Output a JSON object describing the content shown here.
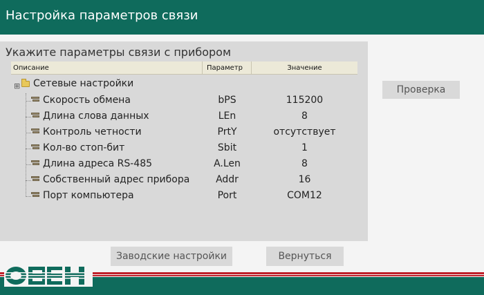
{
  "window": {
    "title": "Настройка параметров связи"
  },
  "panel": {
    "heading": "Укажите параметры связи с прибором",
    "columns": {
      "description": "Описание",
      "parameter": "Параметр",
      "value": "Значение"
    },
    "group_label": "Сетевые настройки",
    "rows": [
      {
        "name": "Скорость обмена",
        "param": "bPS",
        "value": "115200"
      },
      {
        "name": "Длина слова данных",
        "param": "LEn",
        "value": "8"
      },
      {
        "name": "Контроль четности",
        "param": "PrtY",
        "value": "отсутствует"
      },
      {
        "name": "Кол-во стоп-бит",
        "param": "Sbit",
        "value": "1"
      },
      {
        "name": "Длина адреса RS-485",
        "param": "A.Len",
        "value": "8"
      },
      {
        "name": "Собственный адрес прибора",
        "param": "Addr",
        "value": "16"
      },
      {
        "name": "Порт компьютера",
        "param": "Port",
        "value": "COM12"
      }
    ]
  },
  "buttons": {
    "check": "Проверка",
    "factory": "Заводские настройки",
    "back": "Вернуться"
  },
  "logo": {
    "text": "ОВЕН"
  },
  "colors": {
    "brand_green": "#0f6b5c",
    "brand_red": "#c0202a",
    "panel_gray": "#d9d9d9"
  }
}
